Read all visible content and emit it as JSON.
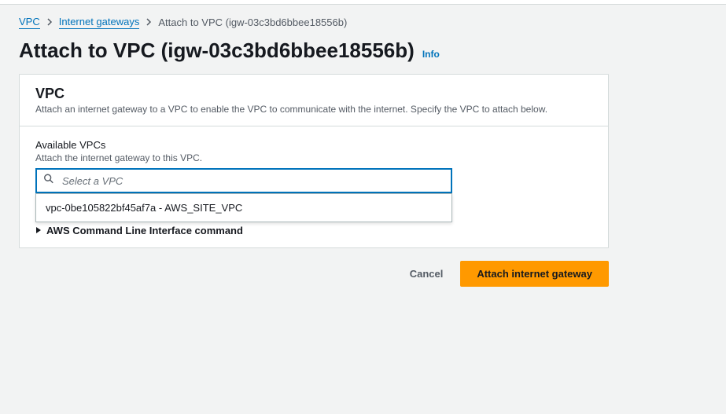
{
  "breadcrumb": {
    "item1": "VPC",
    "item2": "Internet gateways",
    "item3": "Attach to VPC (igw-03c3bd6bbee18556b)"
  },
  "page": {
    "title": "Attach to VPC (igw-03c3bd6bbee18556b)",
    "info": "Info"
  },
  "panel": {
    "title": "VPC",
    "desc": "Attach an internet gateway to a VPC to enable the VPC to communicate with the internet. Specify the VPC to attach below."
  },
  "field": {
    "label": "Available VPCs",
    "help": "Attach the internet gateway to this VPC.",
    "placeholder": "Select a VPC"
  },
  "dropdown": {
    "option1": "vpc-0be105822bf45af7a - AWS_SITE_VPC"
  },
  "expander": {
    "label": "AWS Command Line Interface command"
  },
  "actions": {
    "cancel": "Cancel",
    "attach": "Attach internet gateway"
  }
}
